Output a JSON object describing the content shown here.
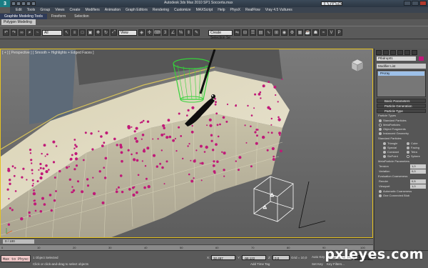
{
  "window": {
    "title": "Autodesk 3ds Max 2010 SP1    Soccerta.max",
    "search_placeholder": "Type a keyword or phrase"
  },
  "menubar": {
    "items": [
      "Edit",
      "Tools",
      "Group",
      "Views",
      "Create",
      "Modifiers",
      "Animation",
      "Graph Editors",
      "Rendering",
      "Customize",
      "MAXScript",
      "Help",
      "PhysX",
      "RealFlow",
      "Vray 4.5 Vultures"
    ]
  },
  "ribbon": {
    "tabs": [
      "Graphite Modeling Tools",
      "Freeform",
      "Selection"
    ],
    "active_panel": "Polygon Modeling"
  },
  "toolbar": {
    "selection_filter": "All",
    "reference_coord": "View",
    "named_selection": "Create Selection Se"
  },
  "viewport": {
    "label": "[ + ] [ Perspective ] [ Smooth + Highlights + Edged Faces ]"
  },
  "command_panel": {
    "object_name": "Ptbdrop01",
    "object_color": "#c0187a",
    "modifier_list_label": "Modifier List",
    "stack_items": [
      "PArray"
    ],
    "rollouts": [
      "Basic Parameters",
      "Particle Generation",
      "Particle Type"
    ],
    "particle_types_title": "Particle Types",
    "particle_types": [
      {
        "label": "Standard Particles",
        "selected": false
      },
      {
        "label": "MetaParticles",
        "selected": true
      },
      {
        "label": "Object Fragments",
        "selected": false
      },
      {
        "label": "Instanced Geometry",
        "selected": false
      }
    ],
    "standard_particles_title": "Standard Particles",
    "standard_particles": [
      {
        "label": "Triangle",
        "selected": false
      },
      {
        "label": "Cube",
        "selected": false
      },
      {
        "label": "Special",
        "selected": false
      },
      {
        "label": "Facing",
        "selected": false
      },
      {
        "label": "Constant",
        "selected": false
      },
      {
        "label": "Tetra",
        "selected": false
      },
      {
        "label": "SixPoint",
        "selected": false
      },
      {
        "label": "Sphere",
        "selected": true
      }
    ],
    "meta_title": "MetaParticle Parameters",
    "tension_label": "Tension",
    "tension_value": "1,0",
    "variation_label": "Variation",
    "variation_value": "0,0",
    "eval_title": "Evaluation Coarseness:",
    "render_label": "Render",
    "render_value": "0,5",
    "viewport_label": "Viewport",
    "viewport_value": "1,0",
    "automatic_label": "Automatic Coarseness",
    "one_connected_label": "One Connected Blob"
  },
  "timeline": {
    "slider_label": "0 / 100",
    "ticks": [
      "0",
      "10",
      "20",
      "30",
      "40",
      "50",
      "60",
      "70",
      "80",
      "90",
      "100"
    ]
  },
  "status": {
    "maxscript_text": "Max to Physc",
    "selection_info": "1 Object Selected",
    "prompt": "Click or click-and-drag to select objects",
    "x_label": "X:",
    "x_value": "32,497",
    "y_label": "Y:",
    "y_value": "-58,122",
    "z_label": "Z:",
    "z_value": "0,0",
    "grid_label": "Grid = 10,0",
    "add_time_tag": "Add Time Tag",
    "auto_key": "Auto Key",
    "set_key": "Set Key",
    "key_filters": "Key Filters...",
    "selected_dropdown": "Selected"
  },
  "watermark": "pxleyes.com"
}
